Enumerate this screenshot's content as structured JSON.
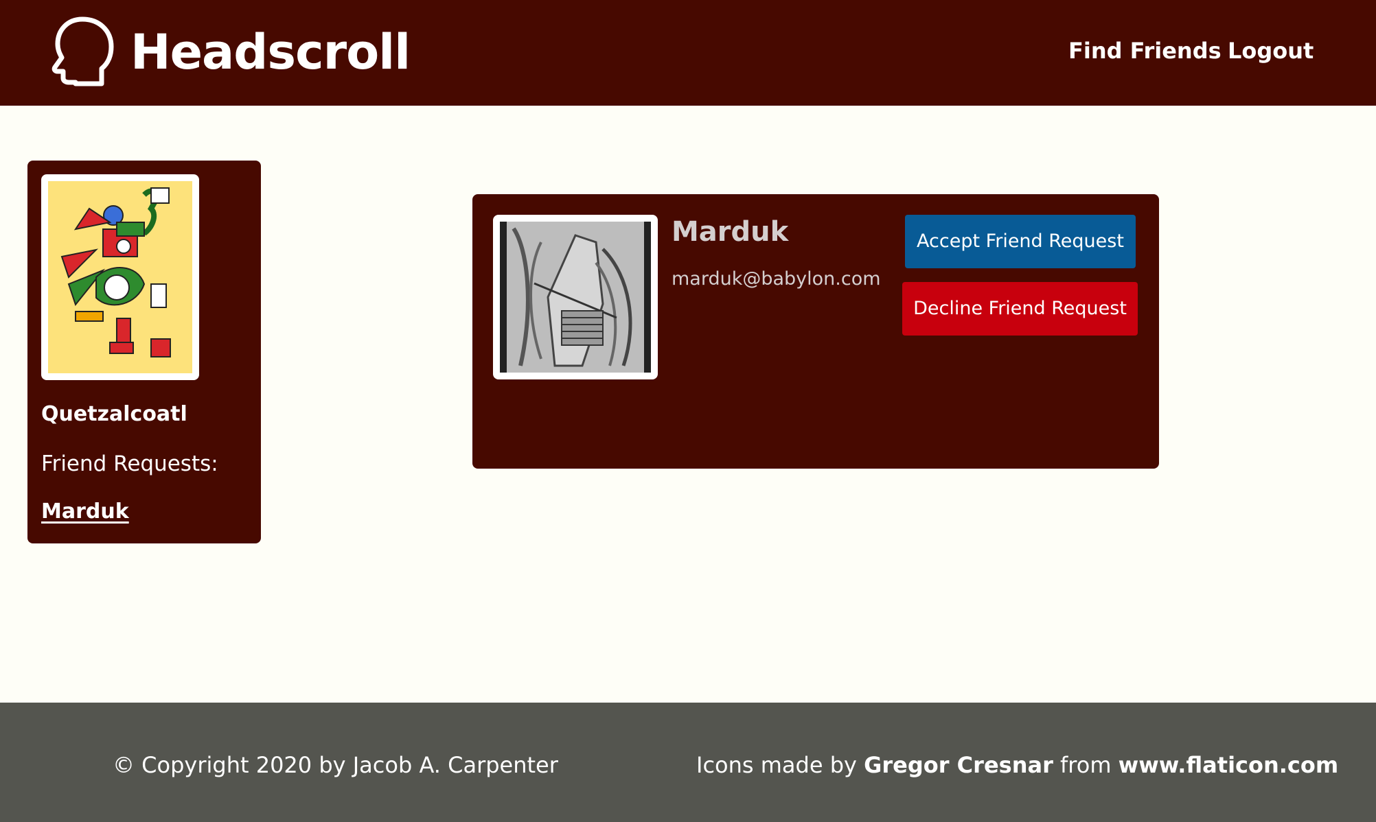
{
  "header": {
    "app_title": "Headscroll",
    "nav": {
      "find_friends": "Find Friends",
      "logout": "Logout"
    }
  },
  "sidebar": {
    "user_name": "Quetzalcoatl",
    "friend_requests_label": "Friend Requests:",
    "requests": [
      "Marduk"
    ]
  },
  "request_card": {
    "name": "Marduk",
    "email": "marduk@babylon.com",
    "accept_label": "Accept Friend Request",
    "decline_label": "Decline Friend Request"
  },
  "footer": {
    "copyright": "© Copyright 2020 by Jacob A. Carpenter",
    "credits_prefix": "Icons made by ",
    "credits_author": "Gregor Cresnar",
    "credits_middle": " from ",
    "credits_site": "www.flaticon.com"
  },
  "colors": {
    "header_bg": "#470900",
    "card_bg": "#470900",
    "page_bg": "#fefef7",
    "accept_btn": "#085b96",
    "decline_btn": "#c8000d",
    "footer_bg": "#54554f"
  },
  "icons": {
    "logo": "head-outline-icon"
  }
}
